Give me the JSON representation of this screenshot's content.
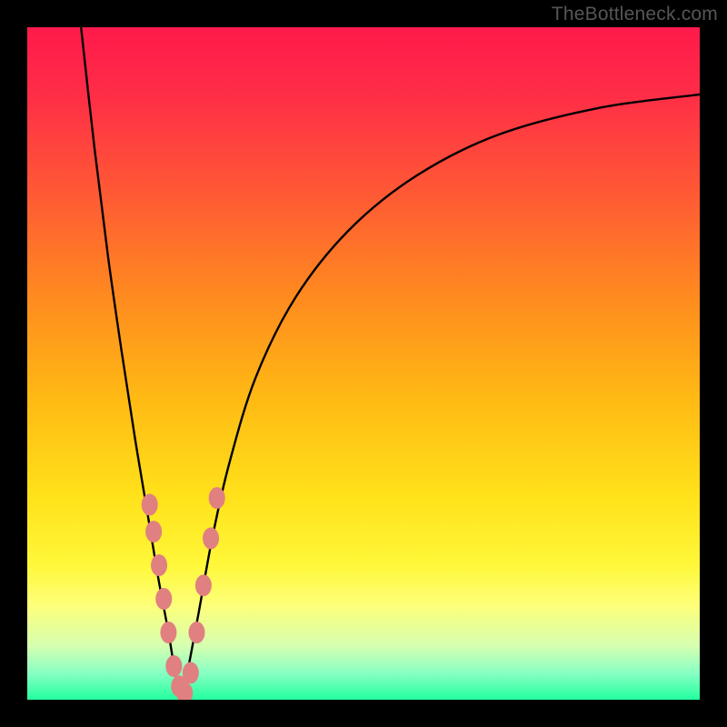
{
  "watermark": "TheBottleneck.com",
  "chart_data": {
    "type": "line",
    "title": "",
    "xlabel": "",
    "ylabel": "",
    "xlim": [
      0,
      100
    ],
    "ylim": [
      0,
      100
    ],
    "grid": false,
    "legend": false,
    "gradient_stops": [
      {
        "offset": 0.0,
        "color": "#ff1a4b"
      },
      {
        "offset": 0.1,
        "color": "#ff2d47"
      },
      {
        "offset": 0.25,
        "color": "#ff5a34"
      },
      {
        "offset": 0.4,
        "color": "#ff8a1f"
      },
      {
        "offset": 0.55,
        "color": "#ffb914"
      },
      {
        "offset": 0.7,
        "color": "#ffe21a"
      },
      {
        "offset": 0.8,
        "color": "#fff83a"
      },
      {
        "offset": 0.86,
        "color": "#fdff7a"
      },
      {
        "offset": 0.92,
        "color": "#d6ffb0"
      },
      {
        "offset": 0.96,
        "color": "#88ffc3"
      },
      {
        "offset": 1.0,
        "color": "#22ff9e"
      }
    ],
    "series": [
      {
        "name": "left-branch",
        "x": [
          8,
          10,
          12,
          14,
          16,
          18,
          19.5,
          21,
          22,
          23
        ],
        "y": [
          100,
          82,
          66,
          52,
          39,
          27,
          18,
          10,
          4,
          0
        ]
      },
      {
        "name": "right-branch",
        "x": [
          23,
          24,
          25.5,
          27.5,
          30,
          34,
          40,
          48,
          58,
          70,
          85,
          100
        ],
        "y": [
          0,
          5,
          13,
          24,
          35,
          48,
          60,
          70,
          78,
          84,
          88,
          90
        ]
      }
    ],
    "markers": {
      "name": "highlight-dots",
      "color": "#e08080",
      "points": [
        {
          "x": 18.2,
          "y": 29
        },
        {
          "x": 18.8,
          "y": 25
        },
        {
          "x": 19.6,
          "y": 20
        },
        {
          "x": 20.3,
          "y": 15
        },
        {
          "x": 21.0,
          "y": 10
        },
        {
          "x": 21.8,
          "y": 5
        },
        {
          "x": 22.6,
          "y": 2
        },
        {
          "x": 23.4,
          "y": 1
        },
        {
          "x": 24.3,
          "y": 4
        },
        {
          "x": 25.2,
          "y": 10
        },
        {
          "x": 26.2,
          "y": 17
        },
        {
          "x": 27.3,
          "y": 24
        },
        {
          "x": 28.2,
          "y": 30
        }
      ]
    }
  }
}
